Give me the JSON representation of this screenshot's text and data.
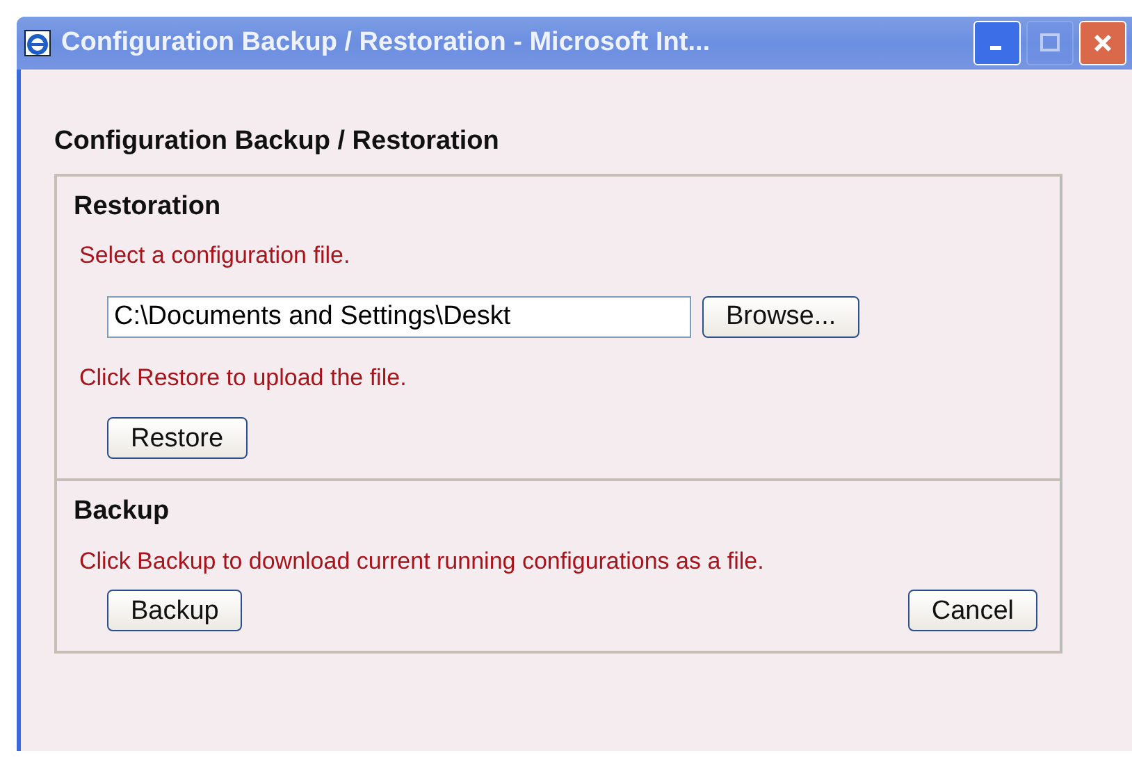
{
  "window": {
    "title": "Configuration Backup / Restoration - Microsoft Int...",
    "controls": [
      {
        "kind": "minimize",
        "disabled": false
      },
      {
        "kind": "maximize",
        "disabled": true
      },
      {
        "kind": "close",
        "disabled": false
      }
    ]
  },
  "heading": "Configuration Backup / Restoration",
  "restoration": {
    "title": "Restoration",
    "instruction": "Select a configuration file.",
    "file_field": {
      "value": "C:\\Documents and Settings\\Deskt"
    },
    "browse_button": "Browse...",
    "restore_instruction": "Click Restore to upload the file.",
    "restore_button": "Restore"
  },
  "backup": {
    "title": "Backup",
    "instruction": "Click Backup to download current running configurations as a file.",
    "backup_button": "Backup",
    "cancel_button": "Cancel"
  }
}
